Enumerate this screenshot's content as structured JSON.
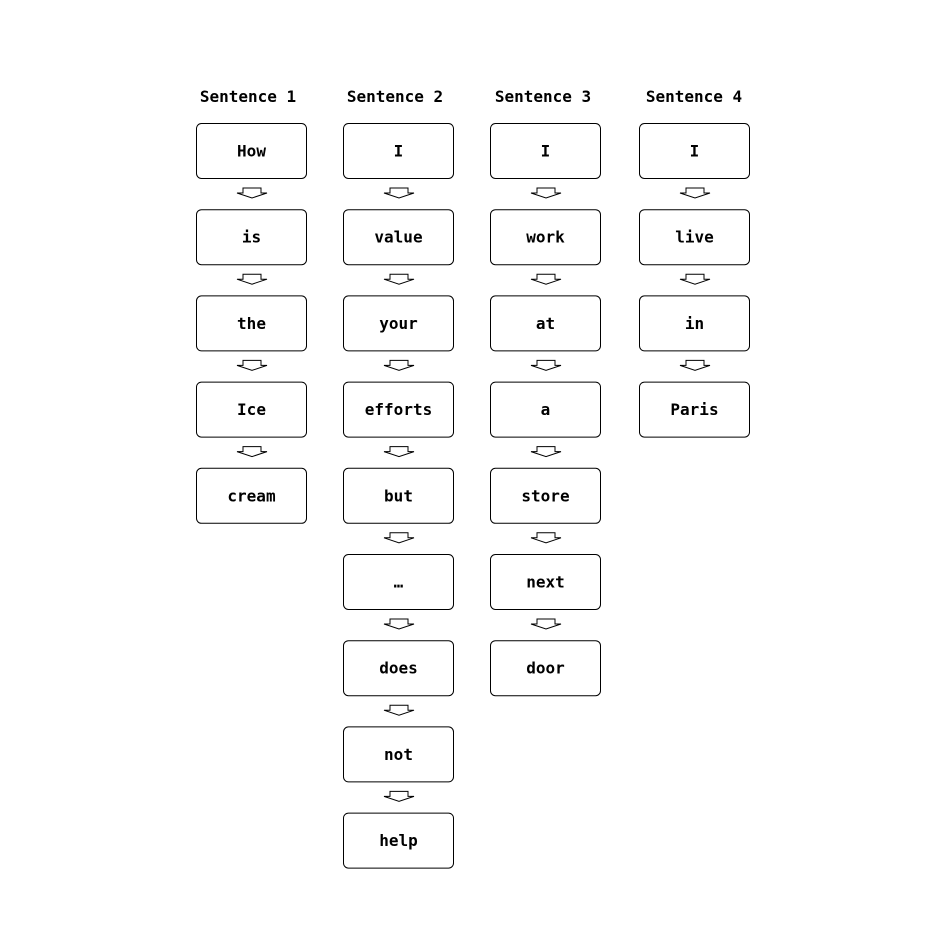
{
  "sentences": [
    {
      "title": "Sentence 1",
      "words": [
        "How",
        "is",
        "the",
        "Ice",
        "cream"
      ]
    },
    {
      "title": "Sentence 2",
      "words": [
        "I",
        "value",
        "your",
        "efforts",
        "but",
        "…",
        "does",
        "not",
        "help"
      ]
    },
    {
      "title": "Sentence 3",
      "words": [
        "I",
        "work",
        "at",
        "a",
        "store",
        "next",
        "door"
      ]
    },
    {
      "title": "Sentence 4",
      "words": [
        "I",
        "live",
        "in",
        "Paris"
      ]
    }
  ],
  "colors": {
    "stroke": "#000000",
    "background": "#ffffff",
    "text": "#000000"
  }
}
